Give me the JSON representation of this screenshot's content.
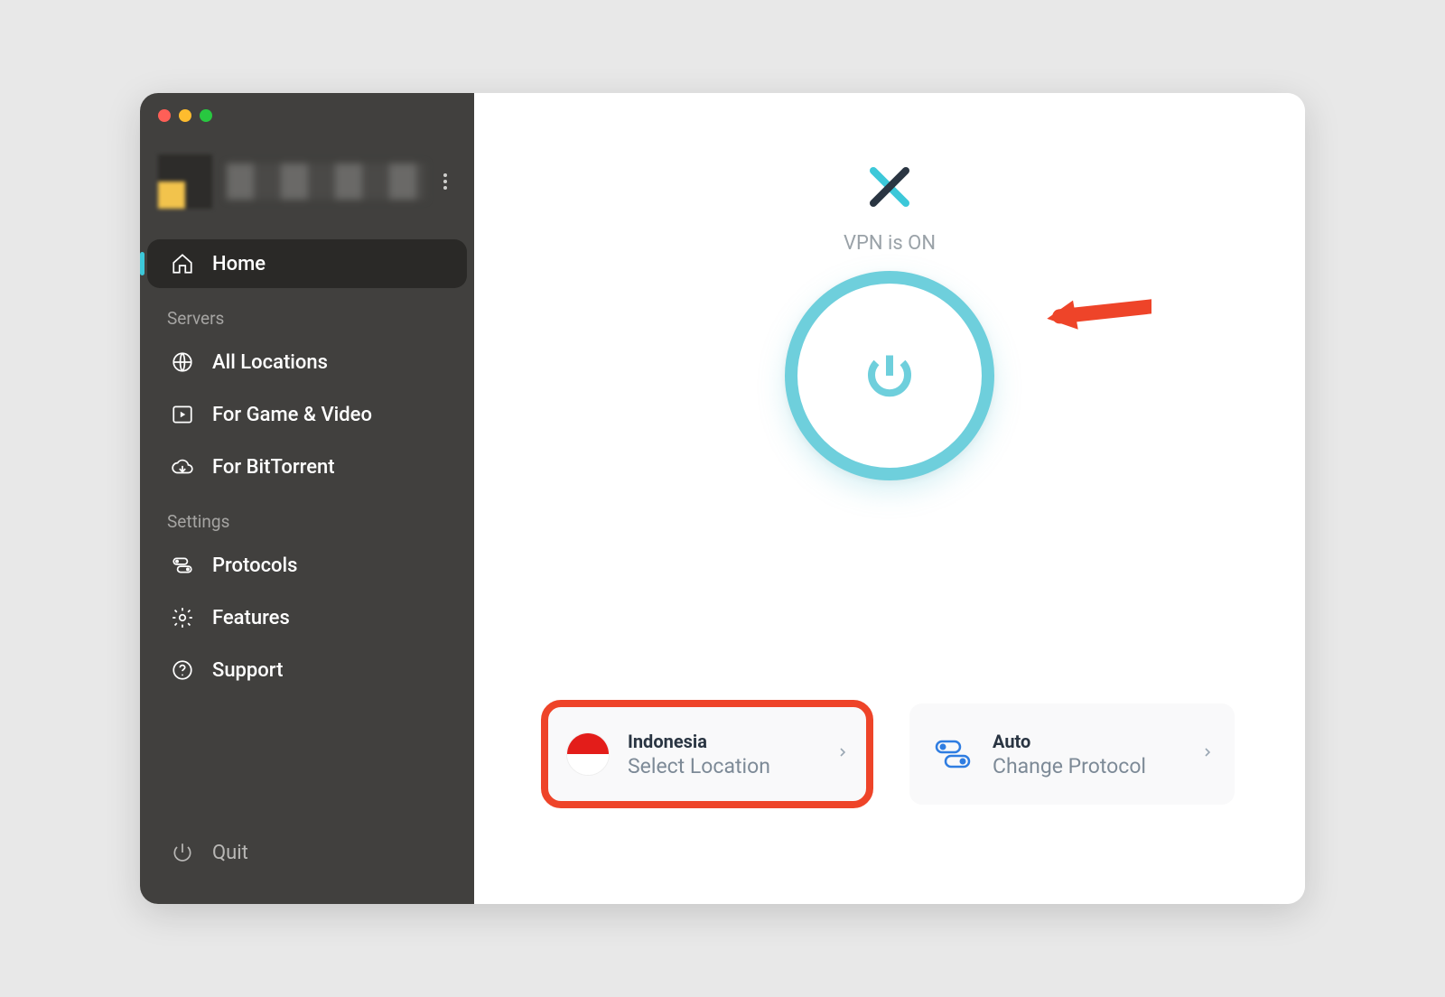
{
  "sidebar": {
    "home_label": "Home",
    "section_servers": "Servers",
    "all_locations_label": "All Locations",
    "game_video_label": "For Game & Video",
    "bittorrent_label": "For BitTorrent",
    "section_settings": "Settings",
    "protocols_label": "Protocols",
    "features_label": "Features",
    "support_label": "Support",
    "quit_label": "Quit"
  },
  "main": {
    "status_text": "VPN is ON",
    "location_card": {
      "title": "Indonesia",
      "subtitle": "Select Location"
    },
    "protocol_card": {
      "title": "Auto",
      "subtitle": "Change Protocol"
    }
  }
}
